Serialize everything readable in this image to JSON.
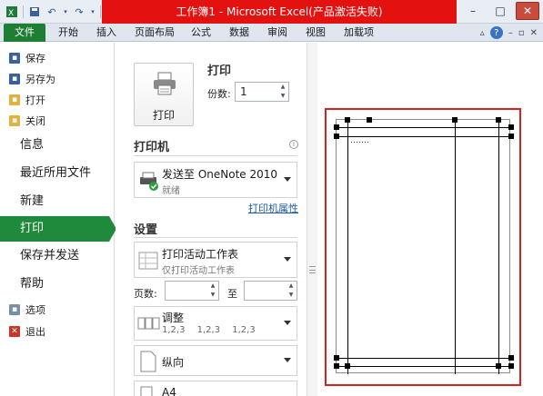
{
  "window": {
    "title": "工作簿1 - Microsoft Excel(产品激活失败)",
    "controls": {
      "minimize": "–",
      "maximize": "□",
      "close": "✕"
    }
  },
  "ribbon": {
    "file_tab": "文件",
    "tabs": [
      "开始",
      "插入",
      "页面布局",
      "公式",
      "数据",
      "审阅",
      "视图",
      "加载项"
    ],
    "help": "?"
  },
  "nav": {
    "small_items": [
      {
        "label": "保存",
        "icon": "save-icon"
      },
      {
        "label": "另存为",
        "icon": "save-as-icon"
      },
      {
        "label": "打开",
        "icon": "open-folder-icon"
      },
      {
        "label": "关闭",
        "icon": "close-folder-icon"
      }
    ],
    "big_items": [
      "信息",
      "最近所用文件",
      "新建",
      "打印",
      "保存并发送",
      "帮助"
    ],
    "active": "打印",
    "bottom_items": [
      {
        "label": "选项",
        "icon": "options-icon"
      },
      {
        "label": "退出",
        "icon": "exit-icon"
      }
    ]
  },
  "print": {
    "title": "打印",
    "button_label": "打印",
    "copies_label": "份数:",
    "copies_value": "1"
  },
  "printer": {
    "section_title": "打印机",
    "name": "发送至 OneNote 2010",
    "status": "就绪",
    "properties_link": "打印机属性"
  },
  "settings": {
    "section_title": "设置",
    "scope_main": "打印活动工作表",
    "scope_sub": "仅打印活动工作表",
    "pages_label": "页数:",
    "pages_to": "至",
    "collate_main": "调整",
    "collate_sub": "1,2,3    1,2,3    1,2,3",
    "orientation": "纵向",
    "paper": "A4"
  },
  "colors": {
    "accent_green": "#1f8a3b",
    "title_highlight_red": "#e41111",
    "preview_frame_red": "#d62121"
  }
}
